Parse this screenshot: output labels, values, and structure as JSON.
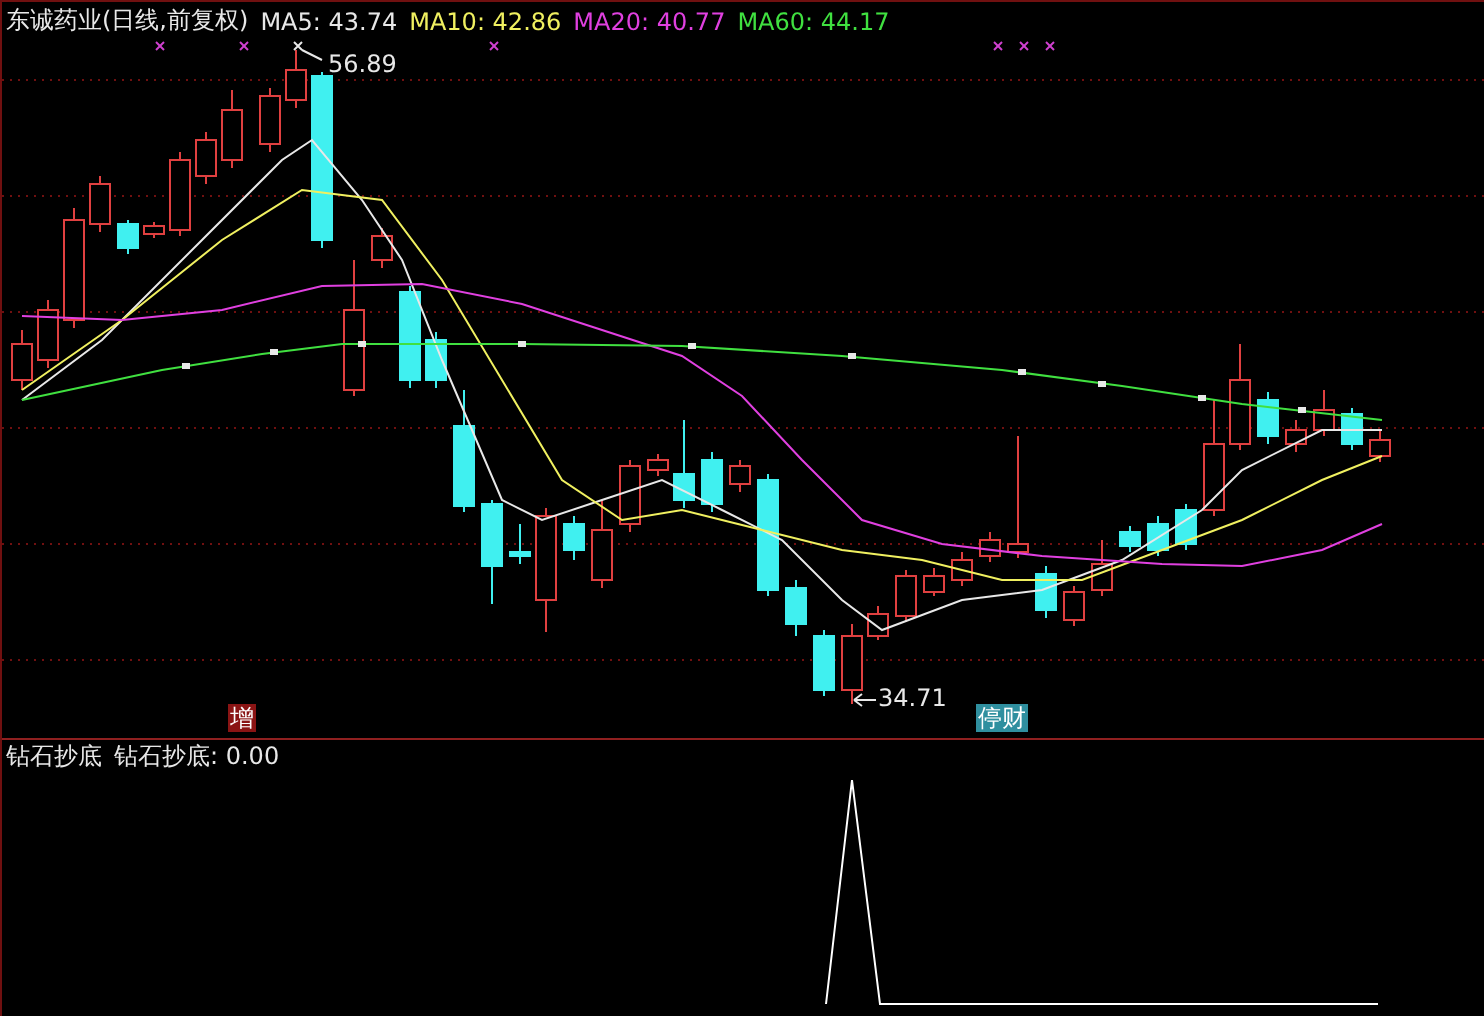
{
  "chart_header": {
    "title": "东诚药业(日线,前复权)",
    "ma_readings": [
      {
        "label": "MA5: 43.74",
        "color": "#e8e8e8"
      },
      {
        "label": "MA10: 42.86",
        "color": "#f0f060"
      },
      {
        "label": "MA20: 40.77",
        "color": "#e040e0"
      },
      {
        "label": "MA60: 44.17",
        "color": "#40e040"
      }
    ]
  },
  "price_labels": [
    {
      "text": "56.89",
      "kind": "high"
    },
    {
      "text": "34.71",
      "kind": "low"
    }
  ],
  "event_tags": [
    {
      "text": "增",
      "color": "#8a1414"
    },
    {
      "text": "停财",
      "color": "#2f8f9f"
    }
  ],
  "indicator": {
    "title": "钻石抄底",
    "reading": "钻石抄底: 0.00"
  }
}
